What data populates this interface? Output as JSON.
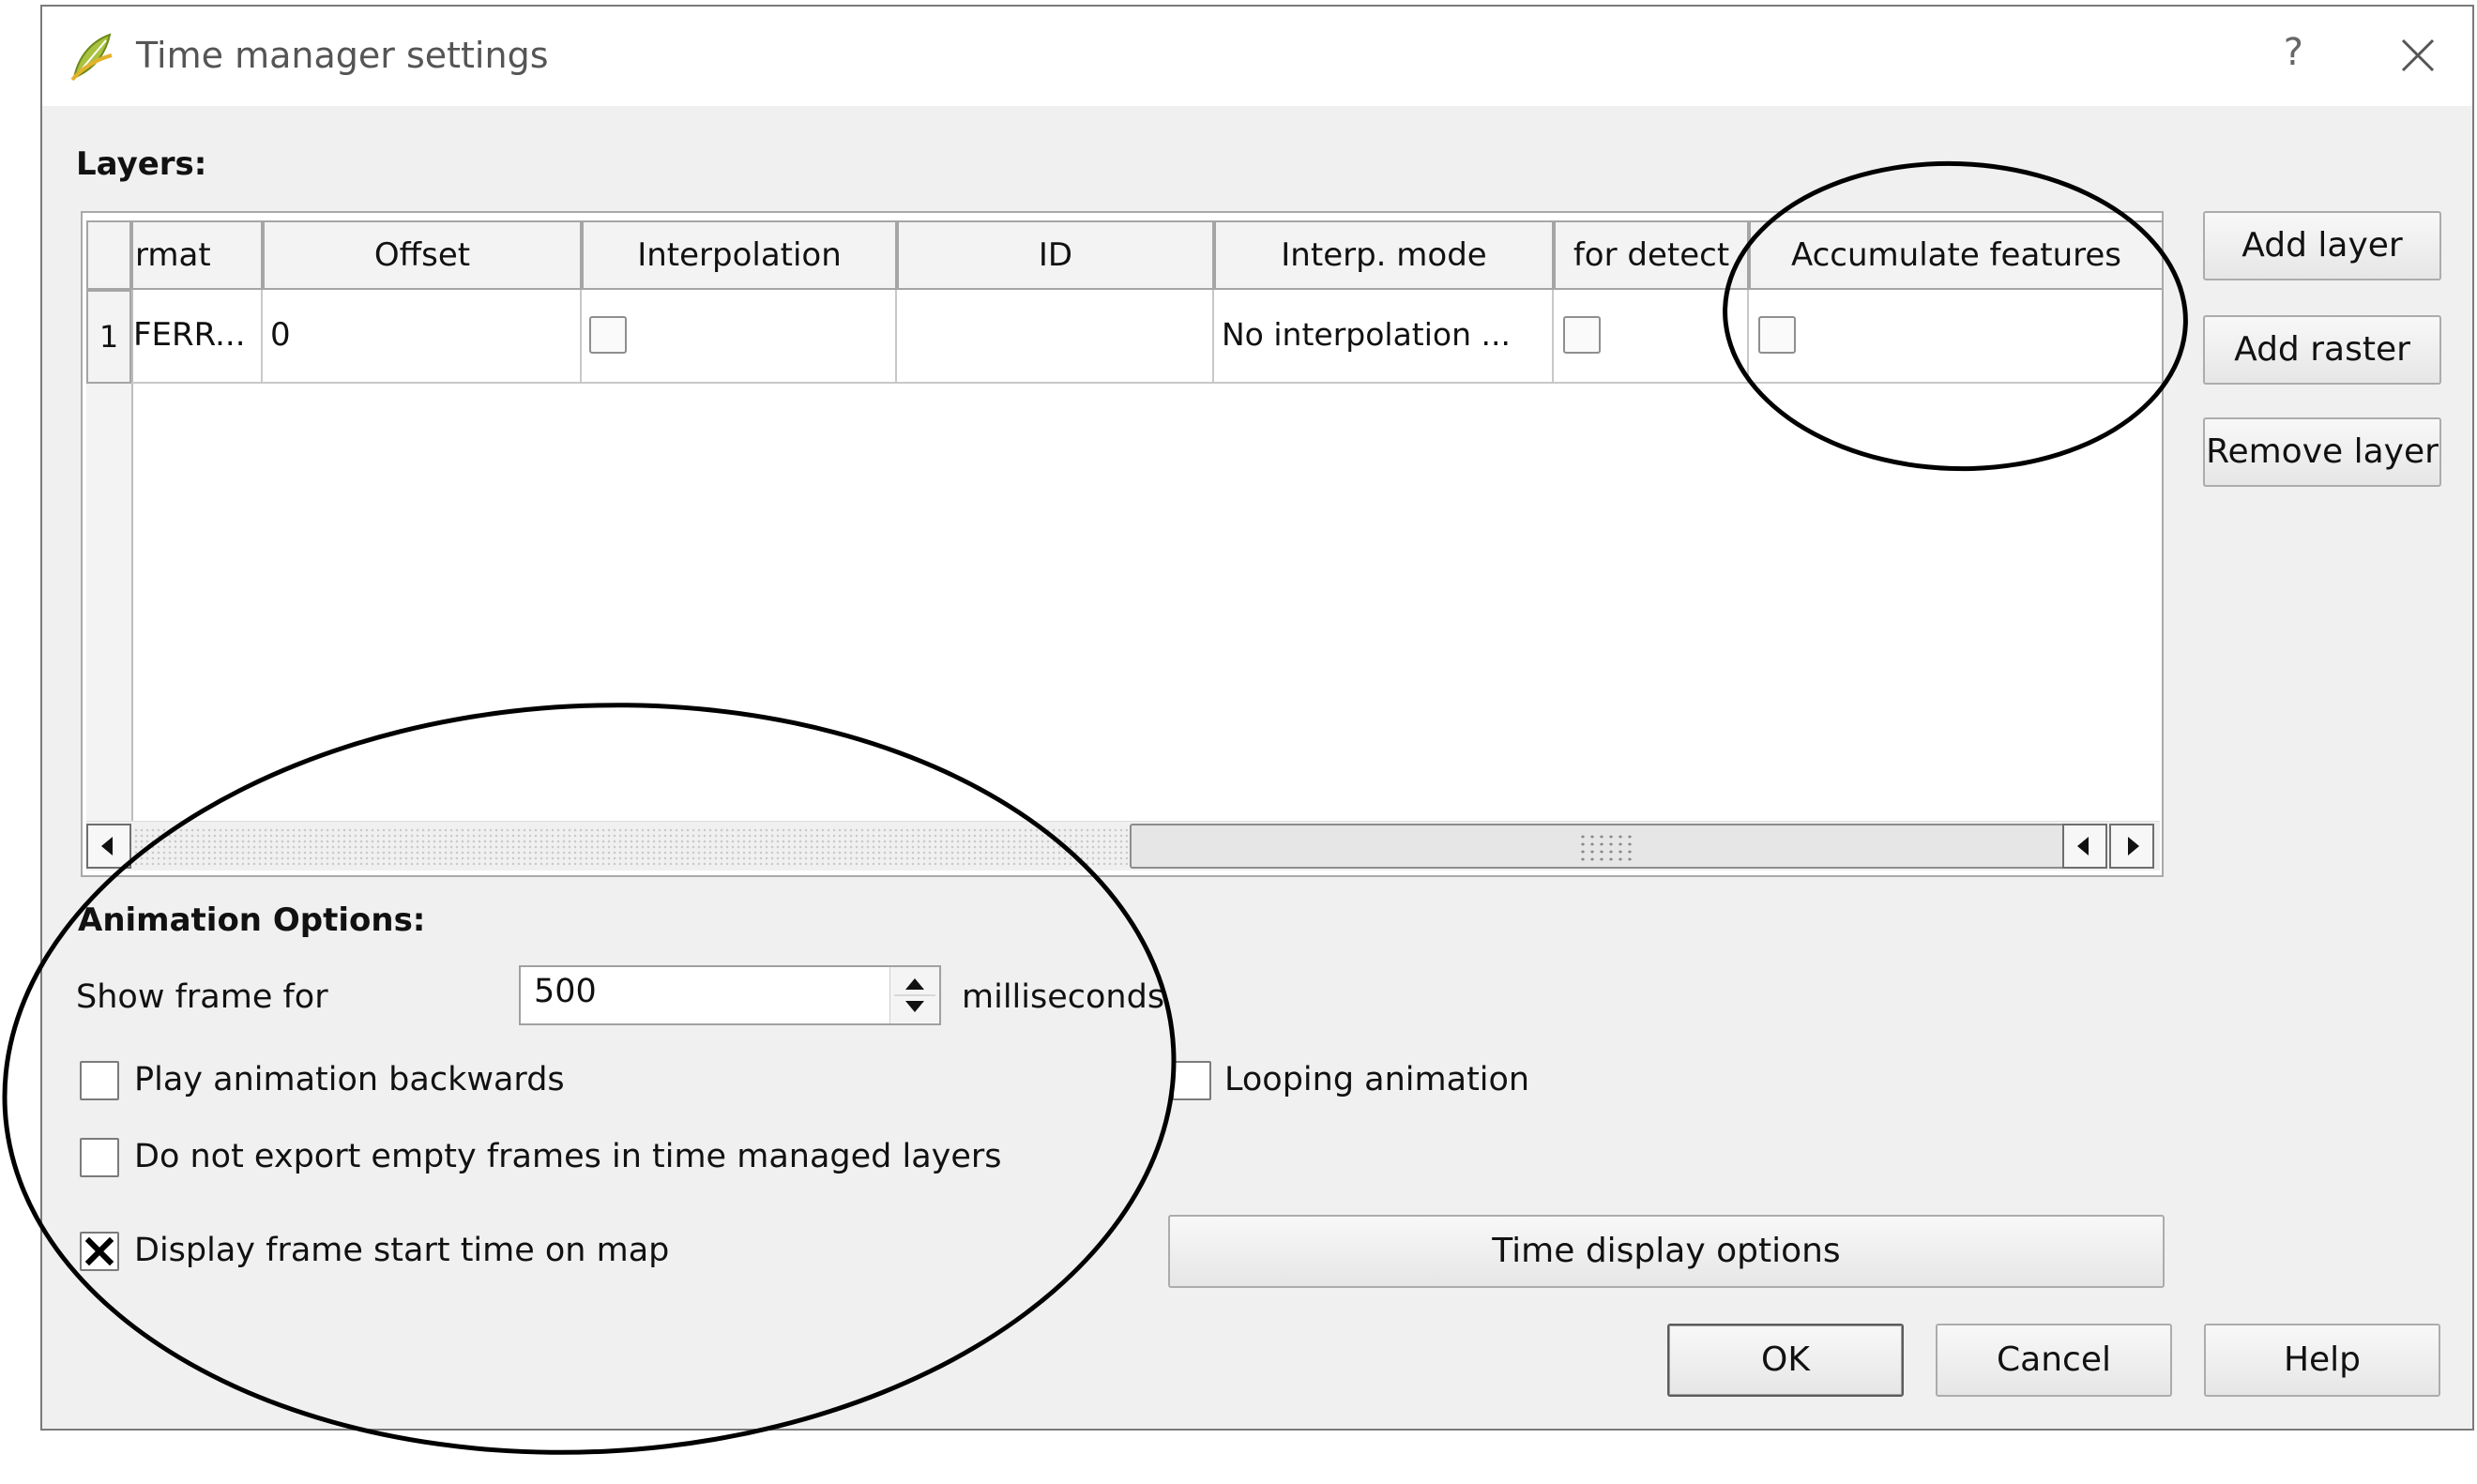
{
  "window": {
    "title": "Time manager settings",
    "help_glyph": "?",
    "app_icon": "qgis-leaf-icon",
    "close_icon": "close-icon"
  },
  "layers": {
    "section_label": "Layers:",
    "columns": [
      "rmat",
      "Offset",
      "Interpolation",
      "ID",
      "Interp. mode",
      "for detect",
      "Accumulate features"
    ],
    "rows": [
      {
        "row_number": "1",
        "format": "FERR...",
        "offset": "0",
        "interpolation": false,
        "id": "",
        "interp_mode": "No interpolation ...",
        "for_detect": false,
        "accumulate_features": false
      }
    ],
    "buttons": {
      "add_layer": "Add layer",
      "add_raster": "Add raster",
      "remove_layer": "Remove layer"
    }
  },
  "animation": {
    "section_label": "Animation Options:",
    "show_frame_label": "Show frame for",
    "show_frame_value": "500",
    "show_frame_unit": "milliseconds",
    "play_backwards": {
      "label": "Play animation backwards",
      "checked": false
    },
    "looping": {
      "label": "Looping animation",
      "checked": false
    },
    "no_export_empty": {
      "label": "Do not export empty frames in time managed layers",
      "checked": false
    },
    "display_start_time": {
      "label": "Display frame start time on map",
      "checked": true
    },
    "time_display_button": "Time display options"
  },
  "footer": {
    "ok": "OK",
    "cancel": "Cancel",
    "help": "Help"
  },
  "annotations": {
    "ellipse_color": "#000000"
  }
}
